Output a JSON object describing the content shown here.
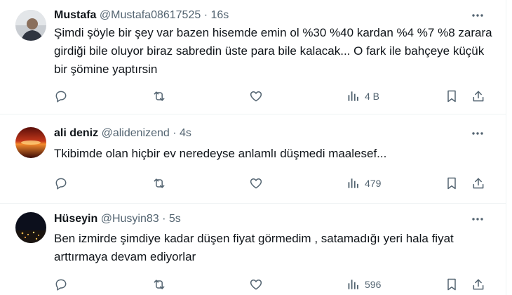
{
  "tweets": [
    {
      "name": "Mustafa",
      "handle": "@Mustafa08617525",
      "separator": "·",
      "time": "16s",
      "text": "Şimdi şöyle bir şey var bazen hisemde emin ol %30 %40 kardan %4 %7 %8 zarara girdiği bile oluyor biraz sabredin üste para bile kalacak... O fark ile bahçeye küçük bir şömine yaptırsin",
      "views": "4 B"
    },
    {
      "name": "ali deniz",
      "handle": "@alidenizend",
      "separator": "·",
      "time": "4s",
      "text": "Tkibimde olan hiçbir ev neredeyse anlamlı düşmedi maalesef...",
      "views": "479"
    },
    {
      "name": "Hüseyin",
      "handle": "@Husyin83",
      "separator": "·",
      "time": "5s",
      "text": "Ben izmirde şimdiye  kadar düşen fiyat görmedim , satamadığı yeri hala fiyat arttırmaya devam ediyorlar",
      "views": "596"
    }
  ],
  "icons": {
    "reply": "reply-icon",
    "retweet": "retweet-icon",
    "like": "heart-icon",
    "views": "views-chart-icon",
    "bookmark": "bookmark-icon",
    "share": "share-icon",
    "more": "more-icon"
  },
  "colors": {
    "text": "#0f1419",
    "secondary": "#536471",
    "border": "#eff3f4"
  }
}
